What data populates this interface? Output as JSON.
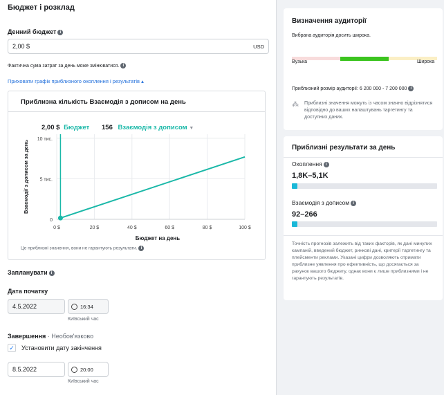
{
  "left": {
    "section_title": "Бюджет і розклад",
    "daily_budget_label": "Денний бюджет",
    "daily_budget_value": "2,00 $",
    "currency": "USD",
    "budget_note": "Фактична сума затрат за день може змінюватися.",
    "hide_graph_link": "Приховати графік приблизного охоплення і результатів",
    "chart_caption": "Це приблизні значення, вони не гарантують результати.",
    "schedule_label": "Запланувати",
    "start_date_label": "Дата початку",
    "start_date": "4.5.2022",
    "start_time": "16:34",
    "start_tz": "Київський час",
    "end_label": "Завершення",
    "end_optional": "· Необов'язково",
    "set_end_date": "Установити дату закінчення",
    "end_date": "8.5.2022",
    "end_time": "20:00",
    "end_tz": "Київський час"
  },
  "chart_data": {
    "type": "line",
    "title": "Приблизна кількість Взаємодія з дописом на день",
    "legend_budget_value": "2,00 $",
    "legend_budget_label": "Бюджет",
    "legend_result_value": "156",
    "legend_result_label": "Взаємодія з дописом",
    "xlabel": "Бюджет на день",
    "ylabel": "Взаємодії з дописом за день",
    "x_ticks": [
      "0 $",
      "20 $",
      "40 $",
      "60 $",
      "80 $",
      "100 $"
    ],
    "y_ticks": [
      "0",
      "5 тис.",
      "10 тис."
    ],
    "xlim": [
      0,
      100
    ],
    "ylim": [
      0,
      10500
    ],
    "grid": true,
    "series": [
      {
        "x": [
          2,
          100
        ],
        "y": [
          156,
          7700
        ]
      }
    ],
    "marker": {
      "x": 2,
      "y": 156
    },
    "color": "#1ab8a8"
  },
  "right": {
    "audience_title": "Визначення аудиторії",
    "audience_status": "Вибрана аудиторія досить широка.",
    "narrow": "Вузька",
    "broad": "Широка",
    "audience_size": "Приблизний розмір аудиторії: 6 200 000 - 7 200 000",
    "audience_note": "Приблизні значення можуть із часом значно відрізнятися відповідно до ваших налаштувань таргетингу та доступних даних.",
    "results_title": "Приблизні результати за день",
    "reach_label": "Охоплення",
    "reach_value": "1,8K–5,1K",
    "reach_fill": 0.04,
    "engagement_label": "Взаємодія з дописом",
    "engagement_value": "92–266",
    "engagement_fill": 0.04,
    "disclaimer": "Точність прогнозів залежить від таких факторів, як дані минулих кампаній, введений бюджет, ринкові дані, критерії таргетингу та плейсменти реклами. Указані цифри дозволяють отримати приблизне уявлення про ефективність, що досягається за рахунок вашого бюджету, однак вони є лише приблизними і не гарантують результатів."
  }
}
